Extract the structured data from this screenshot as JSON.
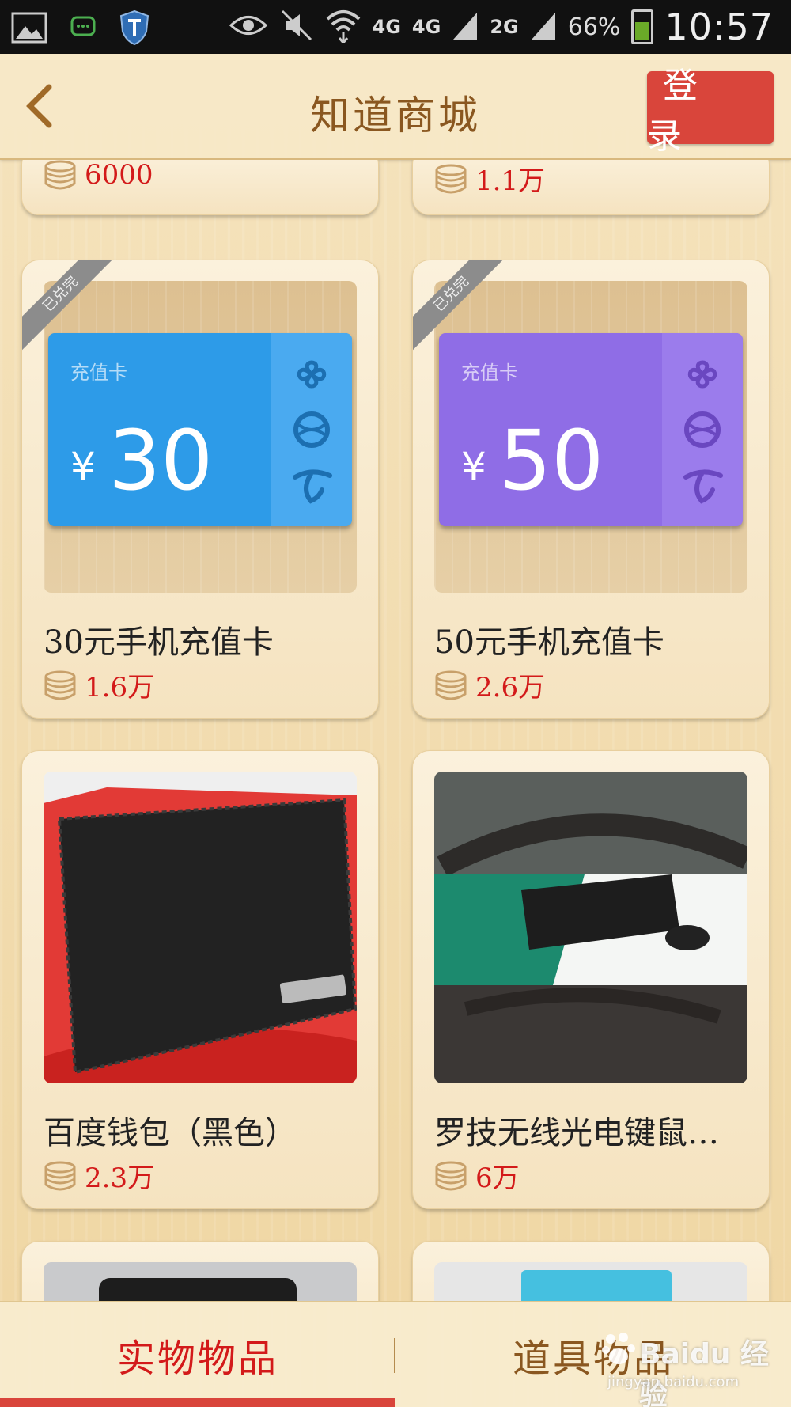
{
  "status_bar": {
    "network_1": "4G",
    "network_2": "4G",
    "network_3": "2G",
    "battery": "66%",
    "time": "10:57",
    "icons": [
      "image-icon",
      "message-icon",
      "shield-icon",
      "eye-icon",
      "mute-icon",
      "wifi-icon",
      "signal-icon"
    ]
  },
  "header": {
    "title": "知道商城",
    "login_label": "登 录"
  },
  "products_top": [
    {
      "price": "6000"
    },
    {
      "price": "1.1万"
    }
  ],
  "products": [
    {
      "title": "30元手机充值卡",
      "price": "1.6万",
      "badge": "已兑完",
      "card_label": "充值卡",
      "card_value": "30",
      "card_yen": "¥",
      "card_color": "#2d9be8"
    },
    {
      "title": "50元手机充值卡",
      "price": "2.6万",
      "badge": "已兑完",
      "card_label": "充值卡",
      "card_value": "50",
      "card_yen": "¥",
      "card_color": "#8f6de6"
    },
    {
      "title": "百度钱包（黑色）",
      "price": "2.3万"
    },
    {
      "title": "罗技无线光电键鼠…",
      "price": "6万"
    }
  ],
  "tabs": [
    {
      "label": "实物物品",
      "active": true
    },
    {
      "label": "道具物品",
      "active": false
    }
  ],
  "watermark": {
    "main": "Baidu 经验",
    "sub": "jingyan.baidu.com"
  },
  "colors": {
    "accent_red": "#d9453b",
    "price_red": "#d31a1a",
    "title_brown": "#8a5720"
  }
}
